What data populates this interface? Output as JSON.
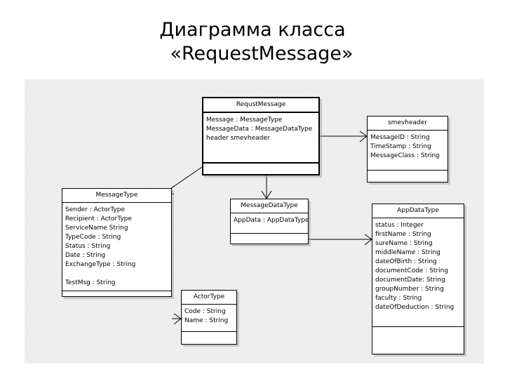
{
  "slide": {
    "title_line_1": "Диаграмма класса",
    "title_line_2": "«RequestMessage»"
  },
  "diagram": {
    "classes": [
      {
        "id": "requestmessage",
        "name": "RequstMessage",
        "attributes": [
          "Message : MessageType",
          "MessageData : MessageDataType",
          "header   smevheader"
        ]
      },
      {
        "id": "smevheader",
        "name": "smevheader",
        "attributes": [
          "MessageID : String",
          "TimeStamp : String",
          "MessageClass : String"
        ]
      },
      {
        "id": "messagetype",
        "name": "MessageType",
        "attributes": [
          "Sender : ActorType",
          "Recipient : ActorType",
          "ServiceName   String",
          "TypeCode : String",
          "Status : String",
          "Date : String",
          "ExchangeType : String",
          "",
          "TestMsg : String"
        ]
      },
      {
        "id": "messagedatatype",
        "name": "MessageDataType",
        "attributes": [
          "AppData : AppDataType"
        ]
      },
      {
        "id": "appdatatype",
        "name": "AppDataType",
        "attributes": [
          "status : Integer",
          "firstName : String",
          "sureName : String",
          "middleName : String",
          "dateOfBirth : String",
          "documentCode : String",
          "documentDate: String",
          "groupNumber : String",
          "faculty : String",
          "dateOfDeduction : String"
        ]
      },
      {
        "id": "actortype",
        "name": "ActorType",
        "attributes": [
          "Code : String",
          "Name : String"
        ]
      }
    ],
    "associations": [
      {
        "from": "requestmessage",
        "to": "smevheader"
      },
      {
        "from": "requestmessage",
        "to": "messagetype"
      },
      {
        "from": "requestmessage",
        "to": "messagedatatype"
      },
      {
        "from": "messagedatatype",
        "to": "appdatatype"
      },
      {
        "from": "messagetype",
        "to": "actortype"
      }
    ]
  }
}
